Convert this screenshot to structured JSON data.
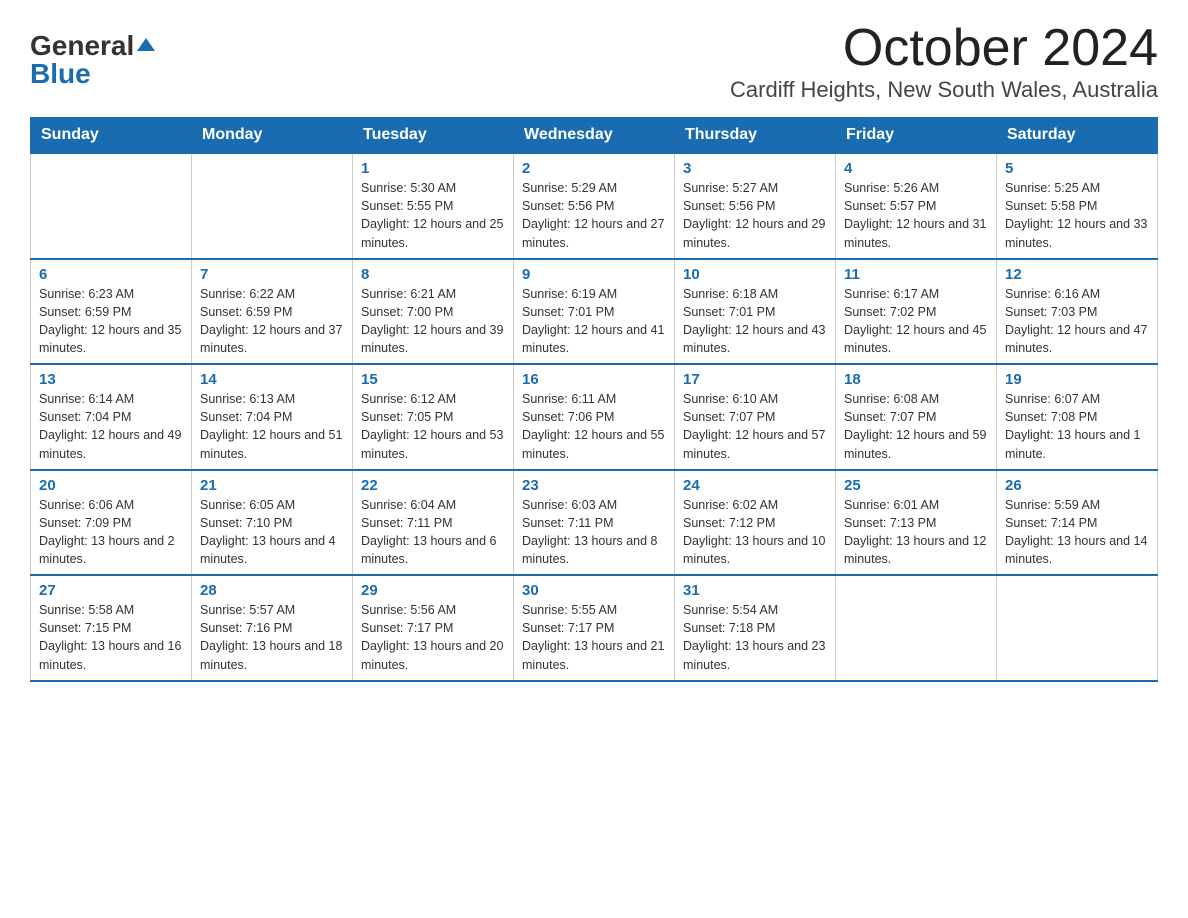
{
  "logo": {
    "general": "General",
    "blue": "Blue"
  },
  "title": "October 2024",
  "location": "Cardiff Heights, New South Wales, Australia",
  "days_of_week": [
    "Sunday",
    "Monday",
    "Tuesday",
    "Wednesday",
    "Thursday",
    "Friday",
    "Saturday"
  ],
  "weeks": [
    [
      {
        "day": "",
        "sunrise": "",
        "sunset": "",
        "daylight": ""
      },
      {
        "day": "",
        "sunrise": "",
        "sunset": "",
        "daylight": ""
      },
      {
        "day": "1",
        "sunrise": "Sunrise: 5:30 AM",
        "sunset": "Sunset: 5:55 PM",
        "daylight": "Daylight: 12 hours and 25 minutes."
      },
      {
        "day": "2",
        "sunrise": "Sunrise: 5:29 AM",
        "sunset": "Sunset: 5:56 PM",
        "daylight": "Daylight: 12 hours and 27 minutes."
      },
      {
        "day": "3",
        "sunrise": "Sunrise: 5:27 AM",
        "sunset": "Sunset: 5:56 PM",
        "daylight": "Daylight: 12 hours and 29 minutes."
      },
      {
        "day": "4",
        "sunrise": "Sunrise: 5:26 AM",
        "sunset": "Sunset: 5:57 PM",
        "daylight": "Daylight: 12 hours and 31 minutes."
      },
      {
        "day": "5",
        "sunrise": "Sunrise: 5:25 AM",
        "sunset": "Sunset: 5:58 PM",
        "daylight": "Daylight: 12 hours and 33 minutes."
      }
    ],
    [
      {
        "day": "6",
        "sunrise": "Sunrise: 6:23 AM",
        "sunset": "Sunset: 6:59 PM",
        "daylight": "Daylight: 12 hours and 35 minutes."
      },
      {
        "day": "7",
        "sunrise": "Sunrise: 6:22 AM",
        "sunset": "Sunset: 6:59 PM",
        "daylight": "Daylight: 12 hours and 37 minutes."
      },
      {
        "day": "8",
        "sunrise": "Sunrise: 6:21 AM",
        "sunset": "Sunset: 7:00 PM",
        "daylight": "Daylight: 12 hours and 39 minutes."
      },
      {
        "day": "9",
        "sunrise": "Sunrise: 6:19 AM",
        "sunset": "Sunset: 7:01 PM",
        "daylight": "Daylight: 12 hours and 41 minutes."
      },
      {
        "day": "10",
        "sunrise": "Sunrise: 6:18 AM",
        "sunset": "Sunset: 7:01 PM",
        "daylight": "Daylight: 12 hours and 43 minutes."
      },
      {
        "day": "11",
        "sunrise": "Sunrise: 6:17 AM",
        "sunset": "Sunset: 7:02 PM",
        "daylight": "Daylight: 12 hours and 45 minutes."
      },
      {
        "day": "12",
        "sunrise": "Sunrise: 6:16 AM",
        "sunset": "Sunset: 7:03 PM",
        "daylight": "Daylight: 12 hours and 47 minutes."
      }
    ],
    [
      {
        "day": "13",
        "sunrise": "Sunrise: 6:14 AM",
        "sunset": "Sunset: 7:04 PM",
        "daylight": "Daylight: 12 hours and 49 minutes."
      },
      {
        "day": "14",
        "sunrise": "Sunrise: 6:13 AM",
        "sunset": "Sunset: 7:04 PM",
        "daylight": "Daylight: 12 hours and 51 minutes."
      },
      {
        "day": "15",
        "sunrise": "Sunrise: 6:12 AM",
        "sunset": "Sunset: 7:05 PM",
        "daylight": "Daylight: 12 hours and 53 minutes."
      },
      {
        "day": "16",
        "sunrise": "Sunrise: 6:11 AM",
        "sunset": "Sunset: 7:06 PM",
        "daylight": "Daylight: 12 hours and 55 minutes."
      },
      {
        "day": "17",
        "sunrise": "Sunrise: 6:10 AM",
        "sunset": "Sunset: 7:07 PM",
        "daylight": "Daylight: 12 hours and 57 minutes."
      },
      {
        "day": "18",
        "sunrise": "Sunrise: 6:08 AM",
        "sunset": "Sunset: 7:07 PM",
        "daylight": "Daylight: 12 hours and 59 minutes."
      },
      {
        "day": "19",
        "sunrise": "Sunrise: 6:07 AM",
        "sunset": "Sunset: 7:08 PM",
        "daylight": "Daylight: 13 hours and 1 minute."
      }
    ],
    [
      {
        "day": "20",
        "sunrise": "Sunrise: 6:06 AM",
        "sunset": "Sunset: 7:09 PM",
        "daylight": "Daylight: 13 hours and 2 minutes."
      },
      {
        "day": "21",
        "sunrise": "Sunrise: 6:05 AM",
        "sunset": "Sunset: 7:10 PM",
        "daylight": "Daylight: 13 hours and 4 minutes."
      },
      {
        "day": "22",
        "sunrise": "Sunrise: 6:04 AM",
        "sunset": "Sunset: 7:11 PM",
        "daylight": "Daylight: 13 hours and 6 minutes."
      },
      {
        "day": "23",
        "sunrise": "Sunrise: 6:03 AM",
        "sunset": "Sunset: 7:11 PM",
        "daylight": "Daylight: 13 hours and 8 minutes."
      },
      {
        "day": "24",
        "sunrise": "Sunrise: 6:02 AM",
        "sunset": "Sunset: 7:12 PM",
        "daylight": "Daylight: 13 hours and 10 minutes."
      },
      {
        "day": "25",
        "sunrise": "Sunrise: 6:01 AM",
        "sunset": "Sunset: 7:13 PM",
        "daylight": "Daylight: 13 hours and 12 minutes."
      },
      {
        "day": "26",
        "sunrise": "Sunrise: 5:59 AM",
        "sunset": "Sunset: 7:14 PM",
        "daylight": "Daylight: 13 hours and 14 minutes."
      }
    ],
    [
      {
        "day": "27",
        "sunrise": "Sunrise: 5:58 AM",
        "sunset": "Sunset: 7:15 PM",
        "daylight": "Daylight: 13 hours and 16 minutes."
      },
      {
        "day": "28",
        "sunrise": "Sunrise: 5:57 AM",
        "sunset": "Sunset: 7:16 PM",
        "daylight": "Daylight: 13 hours and 18 minutes."
      },
      {
        "day": "29",
        "sunrise": "Sunrise: 5:56 AM",
        "sunset": "Sunset: 7:17 PM",
        "daylight": "Daylight: 13 hours and 20 minutes."
      },
      {
        "day": "30",
        "sunrise": "Sunrise: 5:55 AM",
        "sunset": "Sunset: 7:17 PM",
        "daylight": "Daylight: 13 hours and 21 minutes."
      },
      {
        "day": "31",
        "sunrise": "Sunrise: 5:54 AM",
        "sunset": "Sunset: 7:18 PM",
        "daylight": "Daylight: 13 hours and 23 minutes."
      },
      {
        "day": "",
        "sunrise": "",
        "sunset": "",
        "daylight": ""
      },
      {
        "day": "",
        "sunrise": "",
        "sunset": "",
        "daylight": ""
      }
    ]
  ]
}
